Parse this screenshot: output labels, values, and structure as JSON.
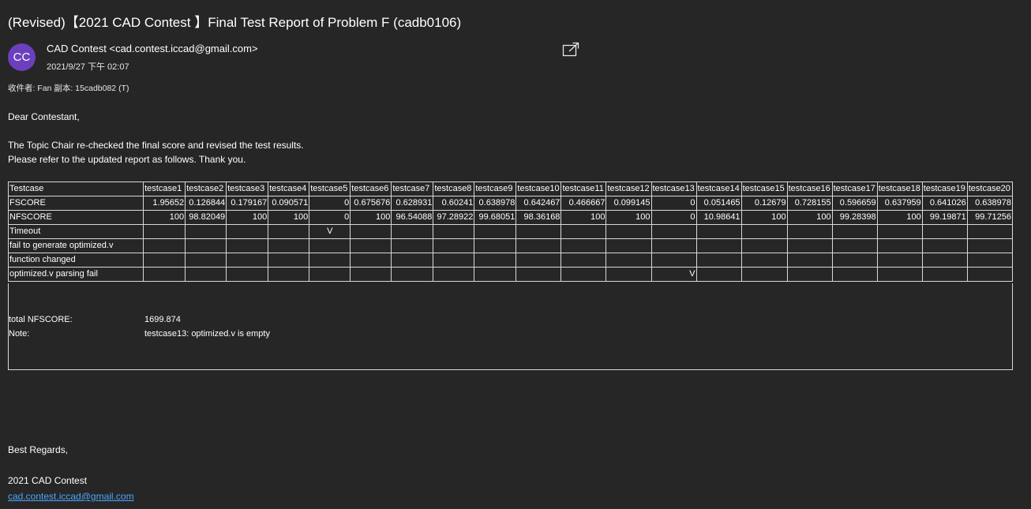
{
  "email": {
    "subject": "(Revised)【2021 CAD Contest 】Final Test Report of Problem F (cadb0106)",
    "avatar_initials": "CC",
    "avatar_color": "#6b3fbd",
    "sender": "CAD Contest <cad.contest.iccad@gmail.com>",
    "date": "2021/9/27 下午 02:07",
    "recipients": "收件者: Fan 副本: 15cadb082 (T)",
    "popout_icon": "popout-icon"
  },
  "body": {
    "greeting": "Dear Contestant,",
    "line1": "The Topic Chair re-checked the final score and revised the test results.",
    "line2": "Please refer to the updated report as follows.  Thank you.",
    "closing": "Best Regards,",
    "signature": "2021 CAD Contest",
    "email_link": "cad.contest.iccad@gmail.com",
    "link_color": "#4ea6ff"
  },
  "table": {
    "header": [
      "Testcase",
      "testcase1",
      "testcase2",
      "testcase3",
      "testcase4",
      "testcase5",
      "testcase6",
      "testcase7",
      "testcase8",
      "testcase9",
      "testcase10",
      "testcase11",
      "testcase12",
      "testcase13",
      "testcase14",
      "testcase15",
      "testcase16",
      "testcase17",
      "testcase18",
      "testcase19",
      "testcase20"
    ],
    "fscore": [
      "FSCORE",
      "1.95652",
      "0.126844",
      "0.179167",
      "0.090571",
      "0",
      "0.675676",
      "0.628931",
      "0.60241",
      "0.638978",
      "0.642467",
      "0.466667",
      "0.099145",
      "0",
      "0.051465",
      "0.12679",
      "0.728155",
      "0.596659",
      "0.637959",
      "0.641026",
      "0.638978"
    ],
    "nfscore": [
      "NFSCORE",
      "100",
      "98.82049",
      "100",
      "100",
      "0",
      "100",
      "96.54088",
      "97.28922",
      "99.68051",
      "98.36168",
      "100",
      "100",
      "0",
      "10.98641",
      "100",
      "100",
      "99.28398",
      "100",
      "99.19871",
      "99.71256"
    ],
    "timeout": [
      "Timeout",
      "",
      "",
      "",
      "",
      "V",
      "",
      "",
      "",
      "",
      "",
      "",
      "",
      "",
      "",
      "",
      "",
      "",
      "",
      "",
      ""
    ],
    "fail_gen": [
      "fail to generate optimized.v",
      "",
      "",
      "",
      "",
      "",
      "",
      "",
      "",
      "",
      "",
      "",
      "",
      "",
      "",
      "",
      "",
      "",
      "",
      "",
      ""
    ],
    "func_changed": [
      "function changed",
      "",
      "",
      "",
      "",
      "",
      "",
      "",
      "",
      "",
      "",
      "",
      "",
      "",
      "",
      "",
      "",
      "",
      "",
      "",
      ""
    ],
    "parse_fail": [
      "optimized.v parsing fail",
      "",
      "",
      "",
      "",
      "",
      "",
      "",
      "",
      "",
      "",
      "",
      "",
      "V",
      "",
      "",
      "",
      "",
      "",
      "",
      ""
    ]
  },
  "summary": {
    "total_label": "total NFSCORE:",
    "total_value": "1699.874",
    "note_label": "Note:",
    "note_value": "testcase13: optimized.v is empty"
  }
}
